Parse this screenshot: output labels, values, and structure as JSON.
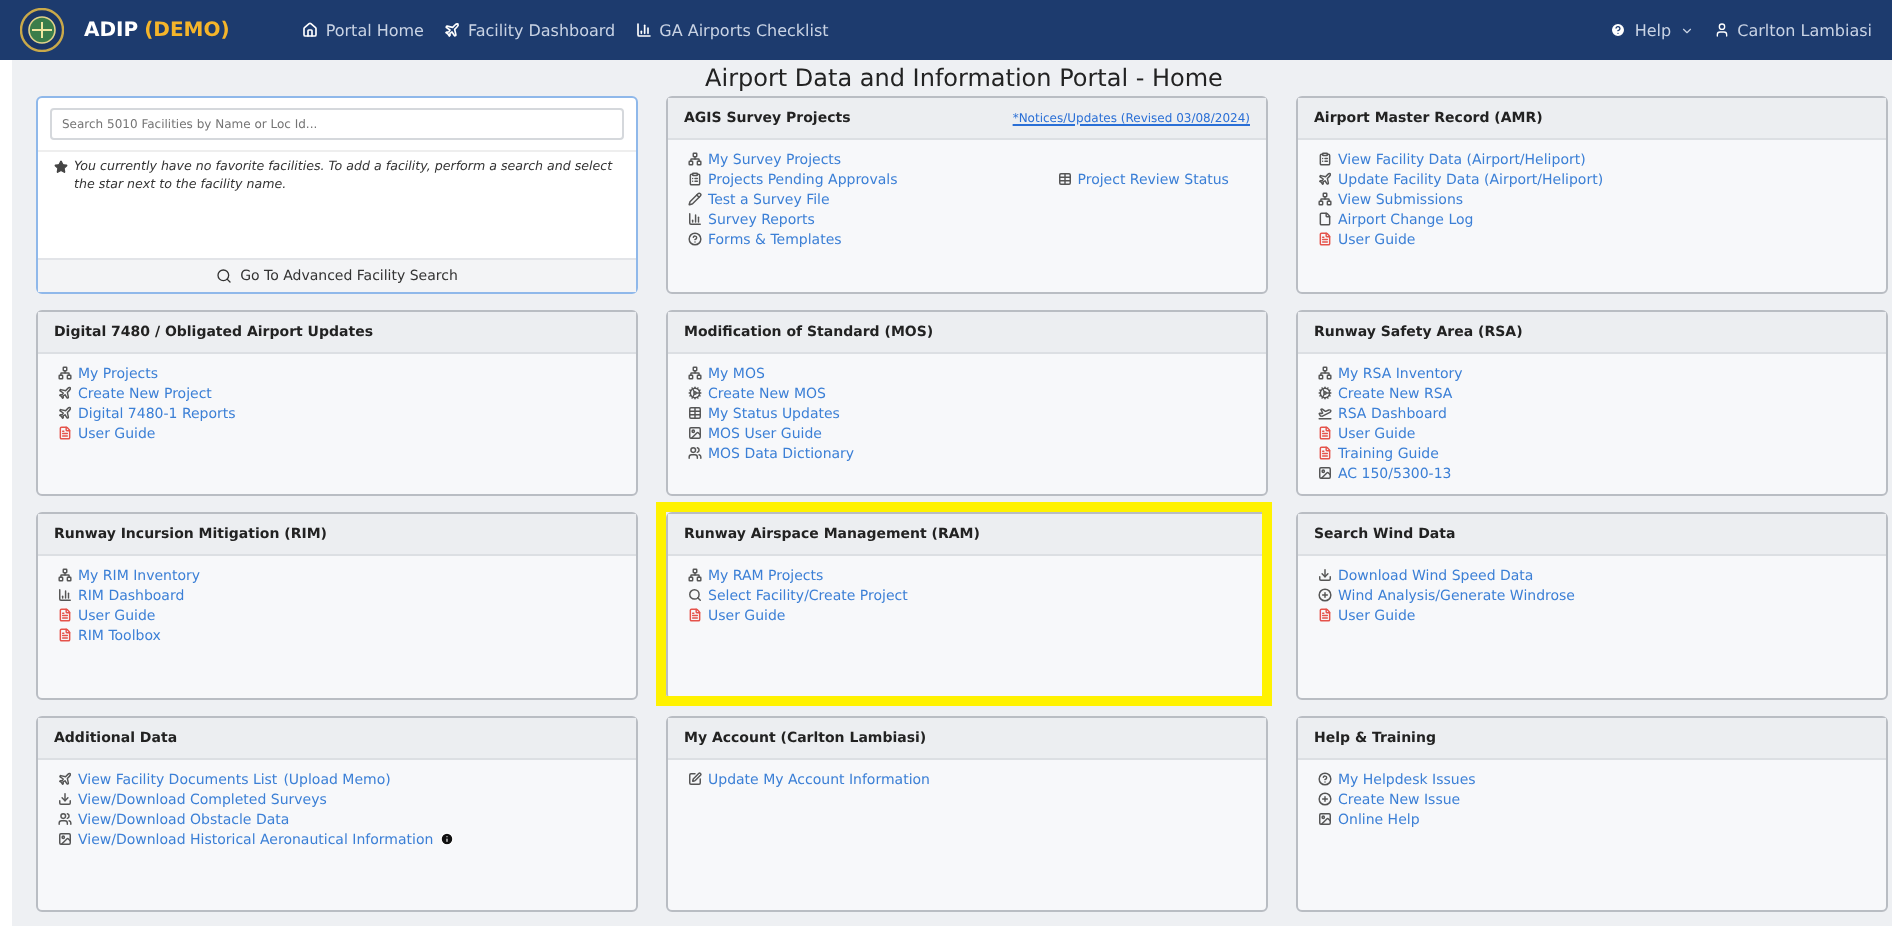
{
  "navbar": {
    "brand": "ADIP",
    "brand_tag": "(DEMO)",
    "links": [
      {
        "label": "Portal Home",
        "kind": "home"
      },
      {
        "label": "Facility Dashboard",
        "kind": "plane"
      },
      {
        "label": "GA Airports Checklist",
        "kind": "chart"
      }
    ],
    "help": "Help",
    "user": "Carlton Lambiasi"
  },
  "page_title": "Airport Data and Information Portal - Home",
  "search_panel": {
    "placeholder": "Search 5010 Facilities by Name or Loc Id...",
    "message": "You currently have no favorite facilities. To add a facility, perform a search and select the star next to the facility name.",
    "button": "Go To Advanced Facility Search"
  },
  "panels": [
    {
      "title": "AGIS Survey Projects",
      "highlighted": false,
      "header_link": "*Notices/Updates (Revised 03/08/2024)",
      "items": [
        {
          "label": "My Survey Projects",
          "kind": "network"
        },
        {
          "label": "Projects Pending Approvals",
          "kind": "clipboard"
        },
        {
          "label": "Test a Survey File",
          "kind": "pencil"
        },
        {
          "label": "Survey Reports",
          "kind": "chart"
        },
        {
          "label": "Forms & Templates",
          "kind": "question"
        }
      ],
      "items_right": [
        {
          "label": "Project Review Status",
          "kind": "table"
        }
      ]
    },
    {
      "title": "Airport Master Record (AMR)",
      "highlighted": false,
      "items": [
        {
          "label": "View Facility Data (Airport/Heliport)",
          "kind": "clipboard"
        },
        {
          "label": "Update Facility Data (Airport/Heliport)",
          "kind": "plane"
        },
        {
          "label": "View Submissions",
          "kind": "network"
        },
        {
          "label": "Airport Change Log",
          "kind": "file"
        },
        {
          "label": "User Guide",
          "kind": "pdf"
        }
      ]
    },
    {
      "title": "Digital 7480 / Obligated Airport Updates",
      "highlighted": false,
      "items": [
        {
          "label": "My Projects",
          "kind": "network"
        },
        {
          "label": "Create New Project",
          "kind": "plane"
        },
        {
          "label": "Digital 7480-1 Reports",
          "kind": "plane"
        },
        {
          "label": "User Guide",
          "kind": "pdf"
        }
      ]
    },
    {
      "title": "Modification of Standard (MOS)",
      "highlighted": false,
      "items": [
        {
          "label": "My MOS",
          "kind": "network"
        },
        {
          "label": "Create New MOS",
          "kind": "cog"
        },
        {
          "label": "My Status Updates",
          "kind": "table"
        },
        {
          "label": "MOS User Guide",
          "kind": "image"
        },
        {
          "label": "MOS Data Dictionary",
          "kind": "sitemap"
        }
      ]
    },
    {
      "title": "Runway Safety Area (RSA)",
      "highlighted": false,
      "items": [
        {
          "label": "My RSA Inventory",
          "kind": "network"
        },
        {
          "label": "Create New RSA",
          "kind": "cog"
        },
        {
          "label": "RSA Dashboard",
          "kind": "takeoff"
        },
        {
          "label": "User Guide",
          "kind": "pdf"
        },
        {
          "label": "Training Guide",
          "kind": "pdf"
        },
        {
          "label": "AC 150/5300-13",
          "kind": "image"
        }
      ]
    },
    {
      "title": "Runway Incursion Mitigation (RIM)",
      "highlighted": false,
      "items": [
        {
          "label": "My RIM Inventory",
          "kind": "network"
        },
        {
          "label": "RIM Dashboard",
          "kind": "chart"
        },
        {
          "label": "User Guide",
          "kind": "pdf"
        },
        {
          "label": "RIM Toolbox",
          "kind": "pdf"
        }
      ]
    },
    {
      "title": "Runway Airspace Management (RAM)",
      "highlighted": true,
      "items": [
        {
          "label": "My RAM Projects",
          "kind": "network"
        },
        {
          "label": "Select Facility/Create Project",
          "kind": "search"
        },
        {
          "label": "User Guide",
          "kind": "pdf"
        }
      ]
    },
    {
      "title": "Search Wind Data",
      "highlighted": false,
      "items": [
        {
          "label": "Download Wind Speed Data",
          "kind": "download"
        },
        {
          "label": "Wind Analysis/Generate Windrose",
          "kind": "plus"
        },
        {
          "label": "User Guide",
          "kind": "pdf"
        }
      ]
    },
    {
      "title": "Additional Data",
      "highlighted": false,
      "items": [
        {
          "label": "View Facility Documents List",
          "kind": "plane",
          "extra_link": "(Upload Memo)"
        },
        {
          "label": "View/Download Completed Surveys",
          "kind": "download"
        },
        {
          "label": "View/Download Obstacle Data",
          "kind": "sitemap"
        },
        {
          "label": "View/Download Historical Aeronautical Information",
          "kind": "image",
          "info": true
        }
      ]
    },
    {
      "title": "My Account (Carlton Lambiasi)",
      "highlighted": false,
      "items": [
        {
          "label": "Update My Account Information",
          "kind": "edit"
        }
      ]
    },
    {
      "title": "Help & Training",
      "highlighted": false,
      "items": [
        {
          "label": "My Helpdesk Issues",
          "kind": "question"
        },
        {
          "label": "Create New Issue",
          "kind": "plus"
        },
        {
          "label": "Online Help",
          "kind": "image"
        }
      ]
    }
  ]
}
